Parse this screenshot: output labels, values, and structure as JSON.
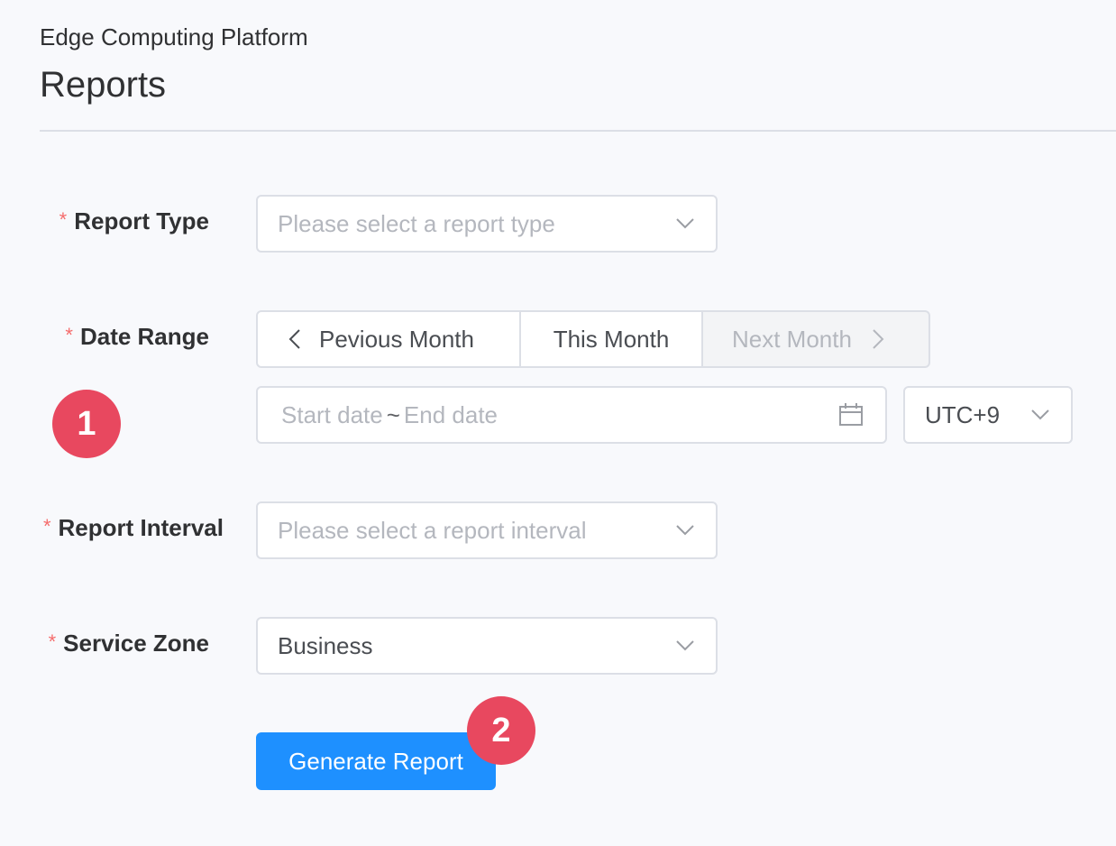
{
  "header": {
    "breadcrumb": "Edge Computing Platform",
    "title": "Reports"
  },
  "form": {
    "required_mark": "*",
    "report_type": {
      "label": "Report Type",
      "placeholder": "Please select a report type"
    },
    "date_range": {
      "label": "Date Range",
      "previous_month": "Pevious Month",
      "this_month": "This Month",
      "next_month": "Next Month",
      "start_placeholder": "Start date",
      "separator": "~",
      "end_placeholder": "End date",
      "timezone": "UTC+9"
    },
    "report_interval": {
      "label": "Report Interval",
      "placeholder": "Please select a report interval"
    },
    "service_zone": {
      "label": "Service Zone",
      "value": "Business"
    },
    "generate_button": "Generate Report"
  },
  "annotations": {
    "badge_1": "1",
    "badge_2": "2"
  },
  "colors": {
    "primary": "#1e90ff",
    "required": "#f56c6c",
    "badge": "#e8485f",
    "border": "#dcdfe6",
    "placeholder": "#b4b7be"
  }
}
